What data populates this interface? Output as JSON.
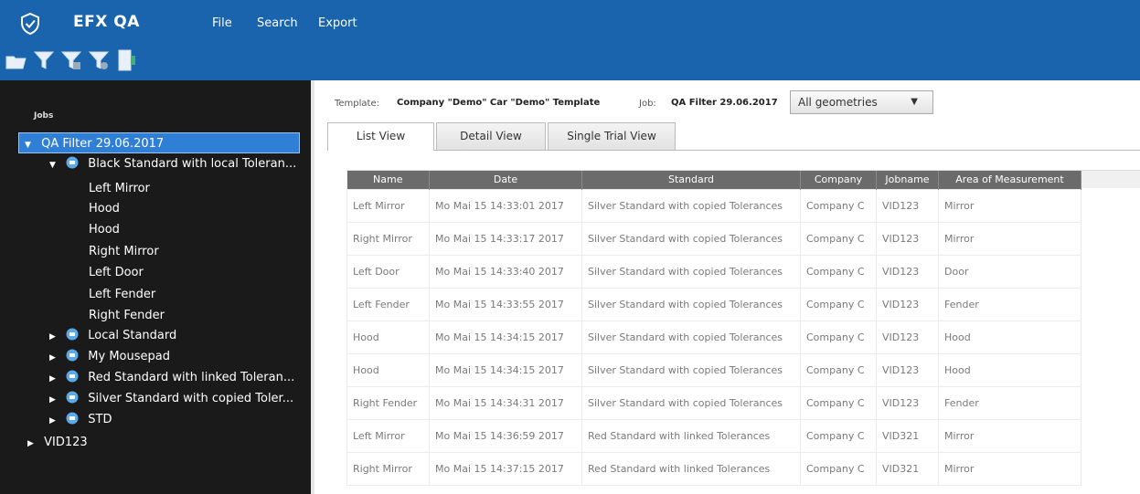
{
  "app": {
    "title": "EFX QA"
  },
  "menu": {
    "file": "File",
    "search": "Search",
    "export": "Export"
  },
  "colors": {
    "header": "#1a63ad",
    "sidebar": "#1a1a1a",
    "selection": "#2f7fd6",
    "table_header": "#6b6b6b",
    "toolbar_icon_green": "#3cb371"
  },
  "toolbar": {
    "items": [
      "folder-open-icon",
      "filter-icon",
      "filter-edit-icon",
      "filter-settings-icon",
      "export-document-icon"
    ]
  },
  "sidebar": {
    "section_label": "Jobs",
    "tree": {
      "root": "QA Filter 29.06.2017",
      "expanded_standard": "Black Standard with local Toleran...",
      "trials": [
        "Left Mirror",
        "Hood",
        "Hood",
        "Right Mirror",
        "Left Door",
        "Left Fender",
        "Right Fender"
      ],
      "standards": [
        "Local Standard",
        "My Mousepad",
        "Red Standard with linked Toleran...",
        "Silver Standard with copied Toler...",
        "STD"
      ],
      "other_job": "VID123"
    }
  },
  "main": {
    "template_label": "Template:",
    "template_value": "Company \"Demo\" Car \"Demo\" Template",
    "job_label": "Job:",
    "job_value": "QA Filter 29.06.2017",
    "geometry_select": "All geometries",
    "tabs": [
      "List View",
      "Detail View",
      "Single Trial View"
    ],
    "table": {
      "columns": [
        "Name",
        "Date",
        "Standard",
        "Company",
        "Jobname",
        "Area of Measurement"
      ],
      "rows": [
        [
          "Left Mirror",
          "Mo Mai 15 14:33:01 2017",
          "Silver Standard with copied Tolerances",
          "Company C",
          "VID123",
          "Mirror"
        ],
        [
          "Right Mirror",
          "Mo Mai 15 14:33:17 2017",
          "Silver Standard with copied Tolerances",
          "Company C",
          "VID123",
          "Mirror"
        ],
        [
          "Left Door",
          "Mo Mai 15 14:33:40 2017",
          "Silver Standard with copied Tolerances",
          "Company C",
          "VID123",
          "Door"
        ],
        [
          "Left Fender",
          "Mo Mai 15 14:33:55 2017",
          "Silver Standard with copied Tolerances",
          "Company C",
          "VID123",
          "Fender"
        ],
        [
          "Hood",
          "Mo Mai 15 14:34:15 2017",
          "Silver Standard with copied Tolerances",
          "Company C",
          "VID123",
          "Hood"
        ],
        [
          "Hood",
          "Mo Mai 15 14:34:15 2017",
          "Silver Standard with copied Tolerances",
          "Company C",
          "VID123",
          "Hood"
        ],
        [
          "Right Fender",
          "Mo Mai 15 14:34:31 2017",
          "Silver Standard with copied Tolerances",
          "Company C",
          "VID123",
          "Fender"
        ],
        [
          "Left Mirror",
          "Mo Mai 15 14:36:59 2017",
          "Red Standard with linked Tolerances",
          "Company C",
          "VID321",
          "Mirror"
        ],
        [
          "Right Mirror",
          "Mo Mai 15 14:37:15 2017",
          "Red Standard with linked Tolerances",
          "Company C",
          "VID321",
          "Mirror"
        ]
      ]
    }
  }
}
